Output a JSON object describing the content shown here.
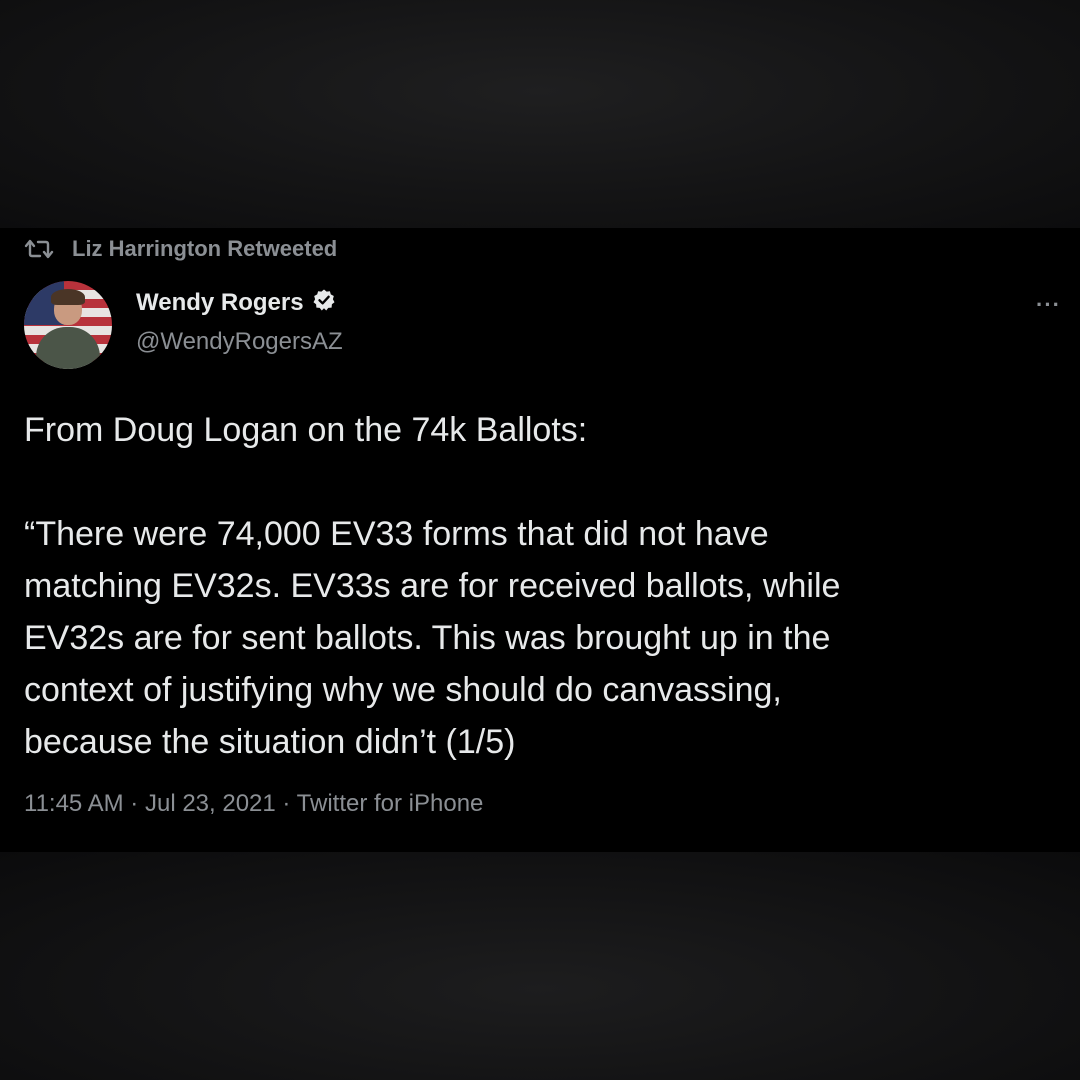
{
  "retweet": {
    "label": "Liz Harrington Retweeted",
    "icon": "retweet-icon"
  },
  "author": {
    "display_name": "Wendy Rogers",
    "handle": "@WendyRogersAZ",
    "verified": true,
    "verified_icon": "verified-badge-icon"
  },
  "more_label": "···",
  "tweet": {
    "line1": "From Doug Logan on the 74k Ballots:",
    "lines": [
      "“There were 74,000 EV33 forms that did not have",
      "matching EV32s. EV33s are for received ballots, while",
      "EV32s are for sent ballots. This was brought up in the",
      "context of justifying why we should do canvassing,",
      "because the situation didn’t (1/5)"
    ]
  },
  "meta": {
    "time": "11:45 AM",
    "date": "Jul 23, 2021",
    "source": "Twitter for iPhone"
  },
  "colors": {
    "text_primary": "#e7e9ea",
    "text_secondary": "#8b8f94",
    "card_bg": "#000000",
    "verified_badge": "#e7e9ea"
  }
}
